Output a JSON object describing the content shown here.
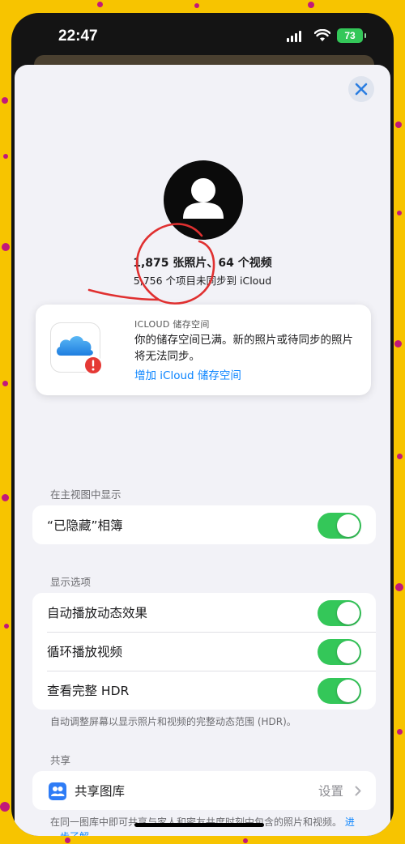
{
  "status_bar": {
    "time": "22:47",
    "battery": "73"
  },
  "header": {
    "close_icon": "close-icon"
  },
  "library": {
    "counts": "1,875 张照片、64 个视频",
    "sync_status": "5,756 个项目未同步到 iCloud"
  },
  "icloud_card": {
    "label": "ICLOUD 储存空间",
    "message": "你的储存空间已满。新的照片或待同步的照片将无法同步。",
    "action_link": "增加 iCloud 储存空间"
  },
  "main_view_section": {
    "title": "在主视图中显示",
    "rows": [
      {
        "label": "“已隐藏”相簿",
        "on": true
      }
    ]
  },
  "display_section": {
    "title": "显示选项",
    "rows": [
      {
        "label": "自动播放动态效果",
        "on": true
      },
      {
        "label": "循环播放视频",
        "on": true
      },
      {
        "label": "查看完整 HDR",
        "on": true
      }
    ],
    "footnote": "自动调整屏幕以显示照片和视频的完整动态范围 (HDR)。"
  },
  "sharing_section": {
    "title": "共享",
    "row": {
      "label": "共享图库",
      "value": "设置"
    },
    "footnote": "在同一图库中即可共享与家人和密友共度时刻中包含的照片和视频。",
    "learn_more": "进一步了解"
  },
  "colors": {
    "accent": "#0a84ff",
    "toggle_on": "#34c759",
    "background": "#f7c400",
    "annotation": "#e03030"
  }
}
